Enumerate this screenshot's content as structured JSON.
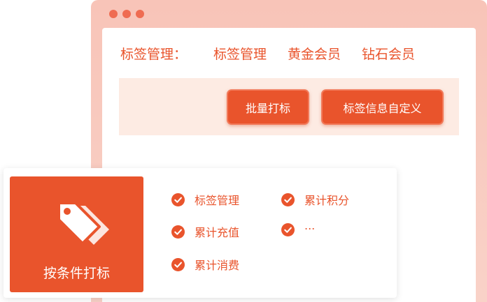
{
  "window": {
    "dot_color": "#ef6c52"
  },
  "tag_nav": {
    "title": "标签管理：",
    "links": [
      "标签管理",
      "黄金会员",
      "钻石会员"
    ]
  },
  "actions": {
    "batch_label": "批量打标",
    "custom_label": "标签信息自定义"
  },
  "feature": {
    "tile_label": "按条件打标",
    "icon": "tag-icon",
    "options": [
      "标签管理",
      "累计充值",
      "累计消费",
      "累计积分",
      "..."
    ]
  },
  "colors": {
    "accent": "#e9542c",
    "frame": "#f8c4b8",
    "action_bar_bg": "#fdebe3"
  }
}
